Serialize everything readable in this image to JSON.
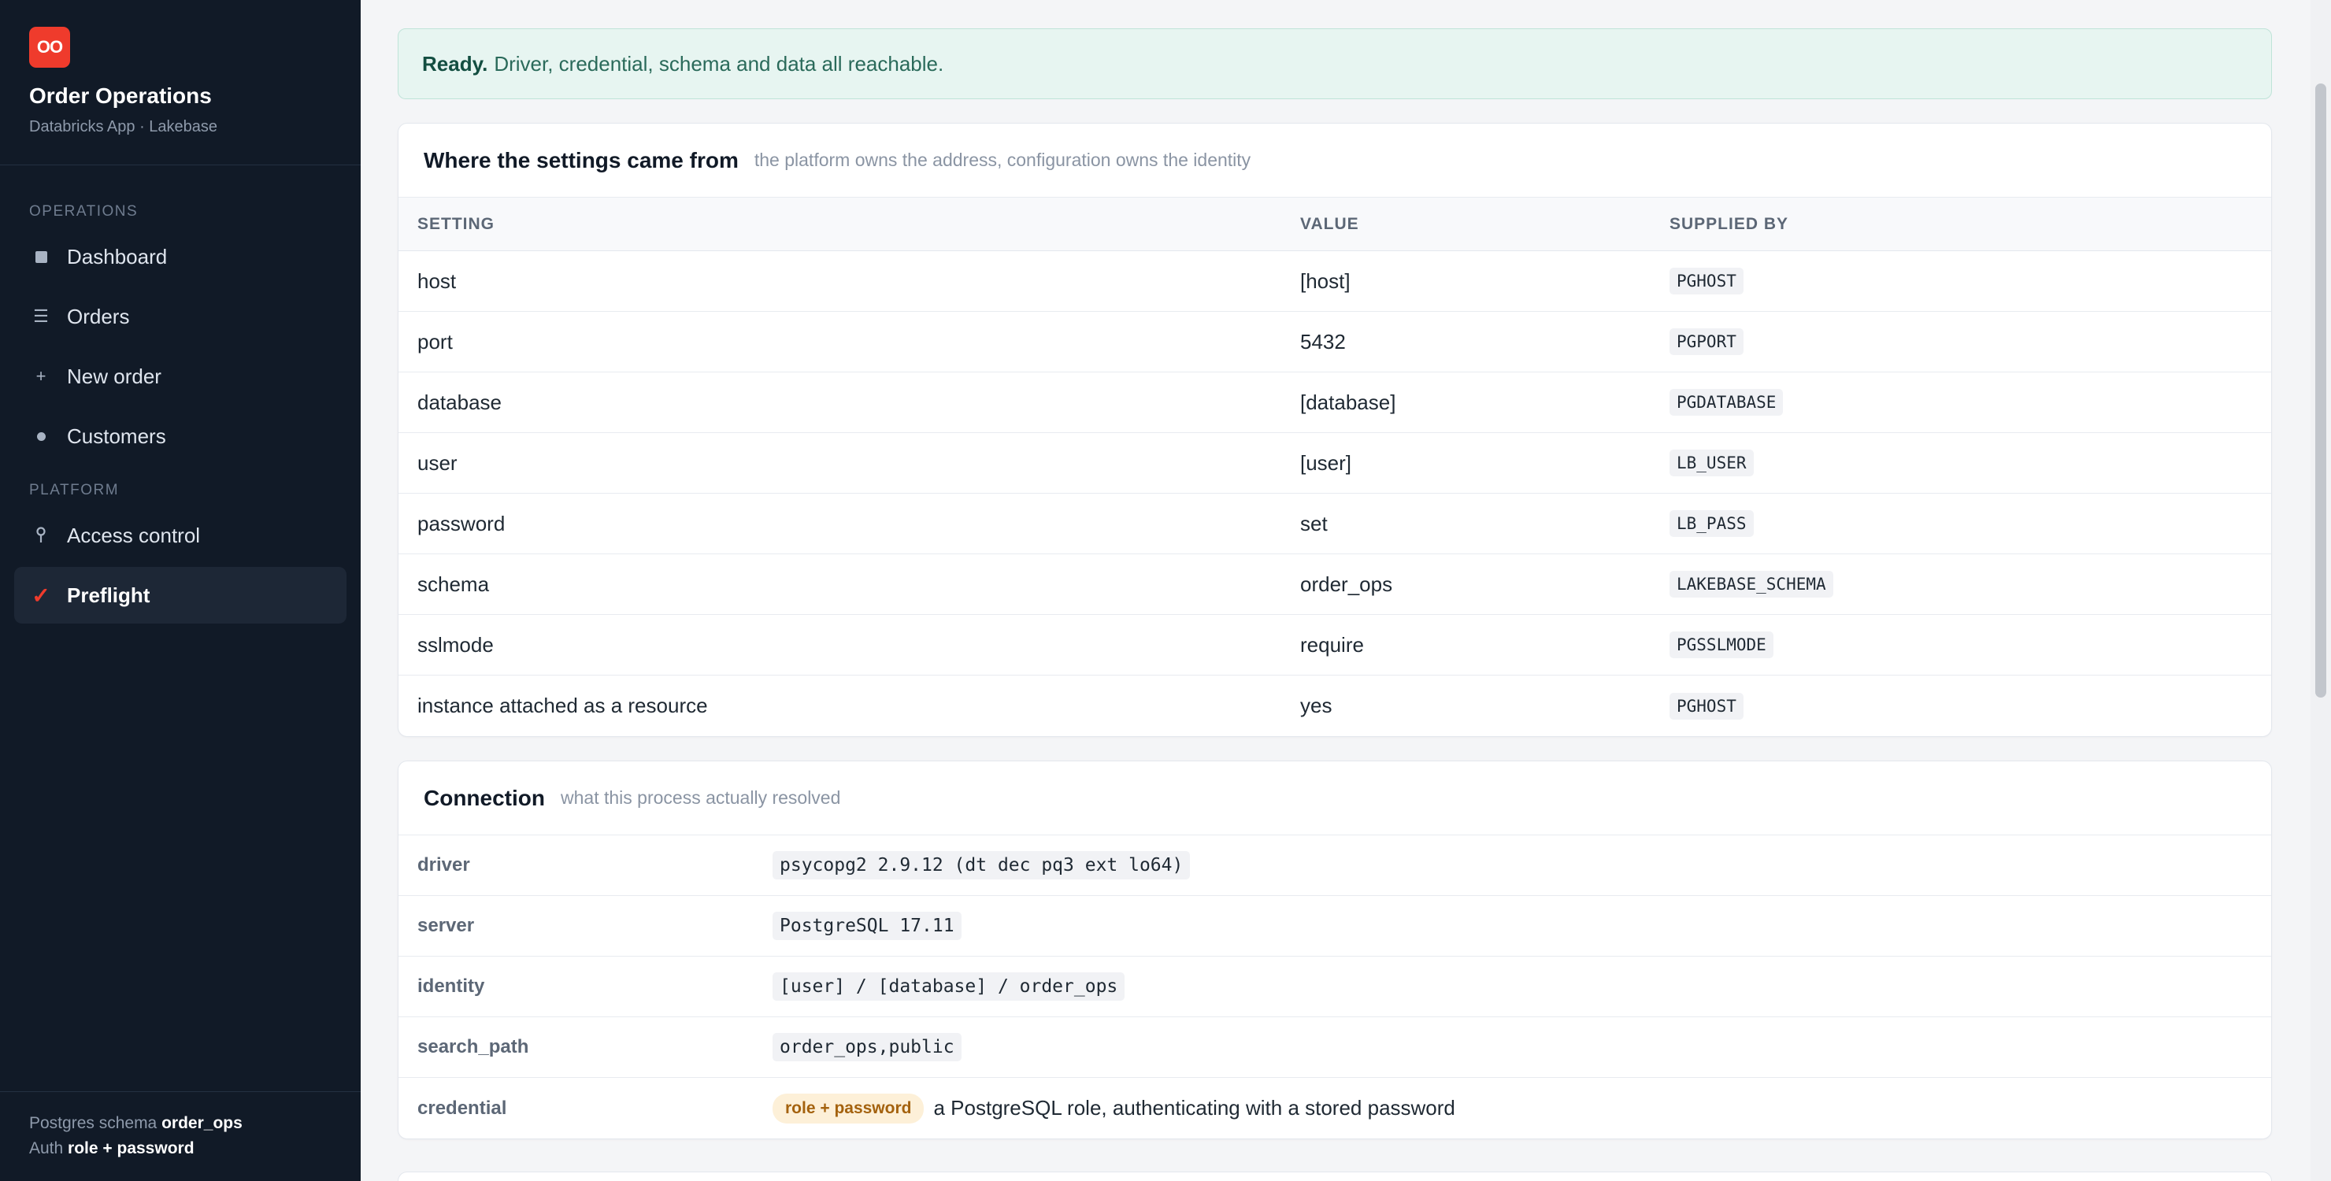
{
  "app": {
    "logo_text": "OO",
    "title": "Order Operations",
    "subtitle": "Databricks App · Lakebase",
    "brand_color": "#ef3b2c"
  },
  "sidebar": {
    "sections": [
      {
        "label": "OPERATIONS",
        "items": [
          {
            "label": "Dashboard",
            "icon": "square-icon"
          },
          {
            "label": "Orders",
            "icon": "list-icon"
          },
          {
            "label": "New order",
            "icon": "plus-icon"
          },
          {
            "label": "Customers",
            "icon": "dot-icon"
          }
        ]
      },
      {
        "label": "PLATFORM",
        "items": [
          {
            "label": "Access control",
            "icon": "key-icon"
          },
          {
            "label": "Preflight",
            "icon": "check-icon",
            "active": true
          }
        ]
      }
    ],
    "footer": {
      "schema_label": "Postgres schema",
      "schema_value": "order_ops",
      "auth_label": "Auth",
      "auth_value": "role + password"
    }
  },
  "banner": {
    "strong": "Ready.",
    "text": "Driver, credential, schema and data all reachable."
  },
  "settings_card": {
    "title": "Where the settings came from",
    "subtitle": "the platform owns the address, configuration owns the identity",
    "columns": [
      "SETTING",
      "VALUE",
      "SUPPLIED BY"
    ],
    "rows": [
      {
        "setting": "host",
        "value": "[host]",
        "supplied_by": "PGHOST"
      },
      {
        "setting": "port",
        "value": "5432",
        "supplied_by": "PGPORT"
      },
      {
        "setting": "database",
        "value": "[database]",
        "supplied_by": "PGDATABASE"
      },
      {
        "setting": "user",
        "value": "[user]",
        "supplied_by": "LB_USER"
      },
      {
        "setting": "password",
        "value": "set",
        "supplied_by": "LB_PASS"
      },
      {
        "setting": "schema",
        "value": "order_ops",
        "supplied_by": "LAKEBASE_SCHEMA"
      },
      {
        "setting": "sslmode",
        "value": "require",
        "supplied_by": "PGSSLMODE"
      },
      {
        "setting": "instance attached as a resource",
        "value": "yes",
        "supplied_by": "PGHOST"
      }
    ]
  },
  "connection_card": {
    "title": "Connection",
    "subtitle": "what this process actually resolved",
    "rows": [
      {
        "key": "driver",
        "value": "psycopg2 2.9.12 (dt dec pq3 ext lo64)"
      },
      {
        "key": "server",
        "value": "PostgreSQL 17.11"
      },
      {
        "key": "identity",
        "value": "[user] / [database] / order_ops"
      },
      {
        "key": "search_path",
        "value": "order_ops,public"
      },
      {
        "key": "credential",
        "badge": "role + password",
        "value": "a PostgreSQL role, authenticating with a stored password"
      }
    ]
  }
}
